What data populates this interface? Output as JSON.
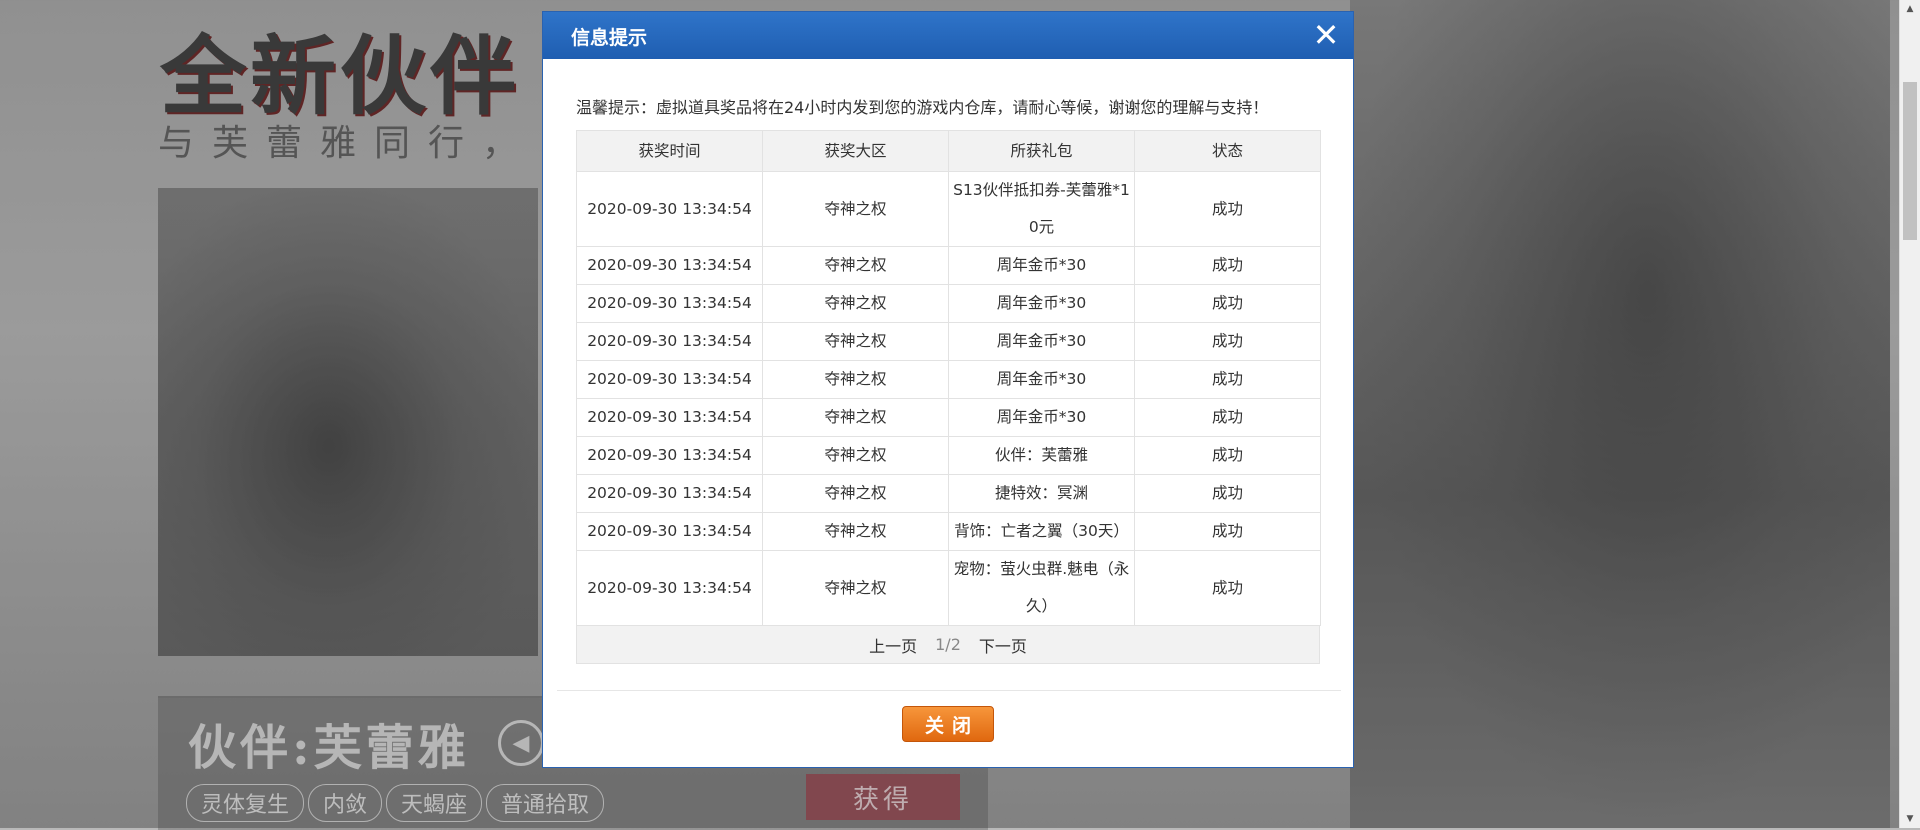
{
  "background": {
    "title": "全新伙伴",
    "subtitle": "与芙蕾雅同行，",
    "partner_name": "伙伴:芙蕾雅",
    "tags": [
      "灵体复生",
      "内敛",
      "天蝎座",
      "普通拾取"
    ],
    "get_button": "获得"
  },
  "modal": {
    "title": "信息提示",
    "close_icon": "✕",
    "notice": "温馨提示：虚拟道具奖品将在24小时内发到您的游戏内仓库，请耐心等候，谢谢您的理解与支持！",
    "headers": [
      "获奖时间",
      "获奖大区",
      "所获礼包",
      "状态"
    ],
    "rows": [
      {
        "time": "2020-09-30 13:34:54",
        "zone": "夺神之权",
        "gift": "S13伙伴抵扣券-芙蕾雅*10元",
        "status": "成功"
      },
      {
        "time": "2020-09-30 13:34:54",
        "zone": "夺神之权",
        "gift": "周年金币*30",
        "status": "成功"
      },
      {
        "time": "2020-09-30 13:34:54",
        "zone": "夺神之权",
        "gift": "周年金币*30",
        "status": "成功"
      },
      {
        "time": "2020-09-30 13:34:54",
        "zone": "夺神之权",
        "gift": "周年金币*30",
        "status": "成功"
      },
      {
        "time": "2020-09-30 13:34:54",
        "zone": "夺神之权",
        "gift": "周年金币*30",
        "status": "成功"
      },
      {
        "time": "2020-09-30 13:34:54",
        "zone": "夺神之权",
        "gift": "周年金币*30",
        "status": "成功"
      },
      {
        "time": "2020-09-30 13:34:54",
        "zone": "夺神之权",
        "gift": "伙伴：芙蕾雅",
        "status": "成功"
      },
      {
        "time": "2020-09-30 13:34:54",
        "zone": "夺神之权",
        "gift": "捷特效：冥渊",
        "status": "成功"
      },
      {
        "time": "2020-09-30 13:34:54",
        "zone": "夺神之权",
        "gift": "背饰：亡者之翼（30天）",
        "status": "成功"
      },
      {
        "time": "2020-09-30 13:34:54",
        "zone": "夺神之权",
        "gift": "宠物：萤火虫群.魅电（永久）",
        "status": "成功"
      }
    ],
    "pager": {
      "prev": "上一页",
      "page": "1/2",
      "next": "下一页"
    },
    "close_button": "关闭"
  },
  "icons": {
    "close": "close-icon",
    "speaker": "speaker-icon"
  }
}
